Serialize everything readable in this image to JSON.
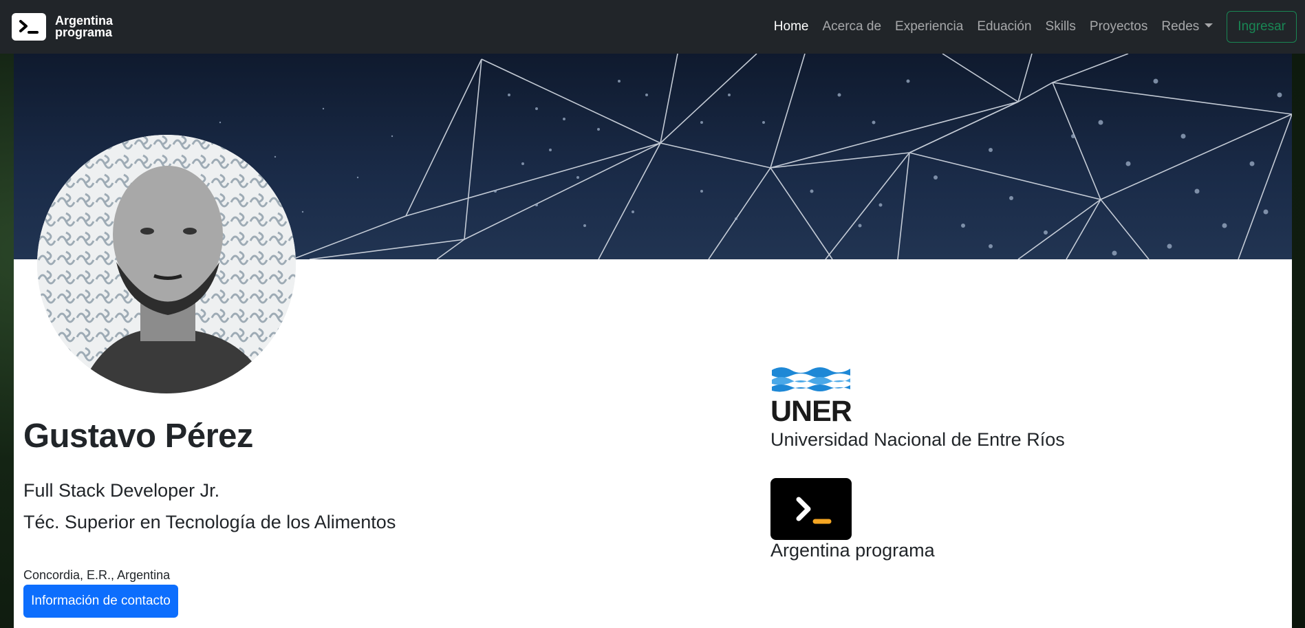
{
  "brand": {
    "line1": "Argentina",
    "line2": "programa",
    "logo_icon": "terminal-icon"
  },
  "nav": {
    "items": [
      {
        "label": "Home",
        "active": true
      },
      {
        "label": "Acerca de"
      },
      {
        "label": "Experiencia"
      },
      {
        "label": "Eduación"
      },
      {
        "label": "Skills"
      },
      {
        "label": "Proyectos"
      },
      {
        "label": "Redes",
        "dropdown": true
      }
    ],
    "login_label": "Ingresar"
  },
  "profile": {
    "name": "Gustavo Pérez",
    "role1": "Full Stack Developer Jr.",
    "role2": "Téc. Superior en Tecnología de los Alimentos",
    "location": "Concordia, E.R., Argentina",
    "contact_label": "Información de contacto"
  },
  "education": [
    {
      "logo_text": "UNER",
      "name": "Universidad Nacional de Entre Ríos"
    },
    {
      "logo_icon": "terminal-icon",
      "name": "Argentina programa"
    }
  ],
  "colors": {
    "navbar": "#212529",
    "primary": "#0d6efd",
    "success": "#198754",
    "banner": "#1a2b48",
    "uner_blue": "#1e88d6",
    "ap_accent": "#f5a623"
  }
}
